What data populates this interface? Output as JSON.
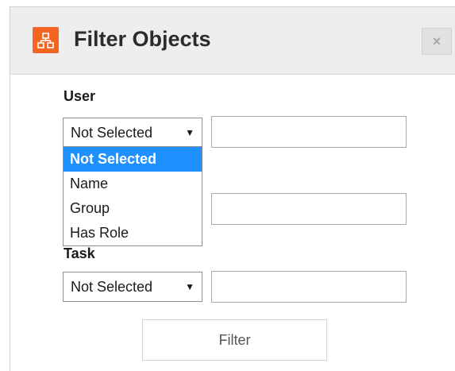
{
  "dialog": {
    "title": "Filter Objects",
    "icon": "hierarchy-icon",
    "close_label": "×",
    "accent_color": "#f26522"
  },
  "fields": [
    {
      "label": "User",
      "selected": "Not Selected",
      "text_value": ""
    },
    {
      "label": "",
      "selected": "",
      "text_value": ""
    },
    {
      "label": "Task",
      "selected": "Not Selected",
      "text_value": ""
    }
  ],
  "dropdown": {
    "open": true,
    "options": [
      "Not Selected",
      "Name",
      "Group",
      "Has Role"
    ],
    "highlighted_index": 0,
    "highlight_color": "#1e90ff"
  },
  "actions": {
    "filter_label": "Filter"
  }
}
